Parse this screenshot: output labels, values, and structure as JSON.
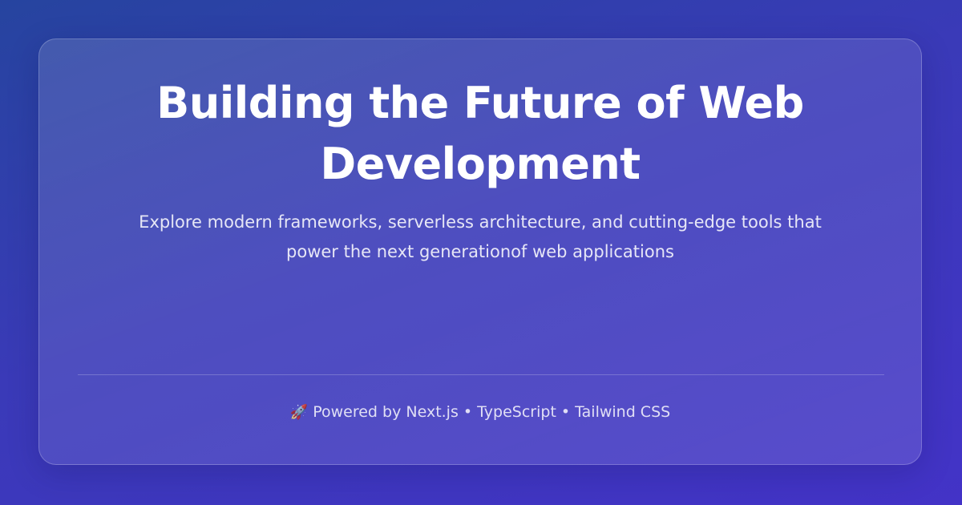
{
  "hero": {
    "title": "Building the Future of Web Development",
    "subtitle": "Explore modern frameworks, serverless architecture, and cutting-edge tools that power the next generationof web applications"
  },
  "footer": {
    "icon": "rocket-icon",
    "icon_glyph": "🚀",
    "text": "Powered by Next.js • TypeScript • Tailwind CSS"
  },
  "colors": {
    "background_start": "#26449f",
    "background_end": "#4333c7",
    "text": "#ffffff"
  }
}
